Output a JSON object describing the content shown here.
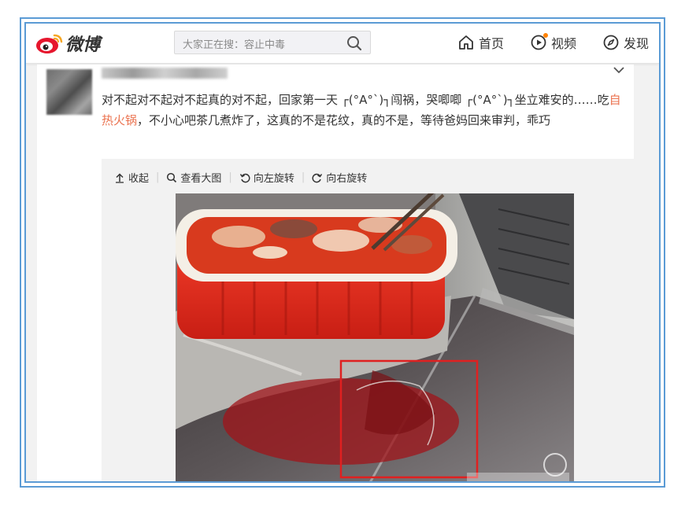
{
  "header": {
    "logo_text": "微博",
    "search_placeholder": "大家正在搜：容止中毒",
    "nav": [
      {
        "label": "首页",
        "icon": "home-icon"
      },
      {
        "label": "视频",
        "icon": "video-icon",
        "has_dot": true
      },
      {
        "label": "发现",
        "icon": "compass-icon"
      }
    ]
  },
  "post": {
    "text_part1": "对不起对不起对不起真的对不起，回家第一天 ┌(°A°`)┐闯祸，哭唧唧 ┌(°A°`)┐坐立难安的……吃",
    "text_link": "自热火锅",
    "text_part2": "，不小心吧茶几煮炸了，这真的不是花纹，真的不是，等待爸妈回来审判，乖巧"
  },
  "media_toolbar": {
    "collapse": "收起",
    "view_large": "查看大图",
    "rotate_left": "向左旋转",
    "rotate_right": "向右旋转"
  },
  "colors": {
    "frame": "#5b9bd5",
    "link": "#eb7350",
    "highlight_box": "#e02020",
    "nav_dot": "#ff8200"
  }
}
